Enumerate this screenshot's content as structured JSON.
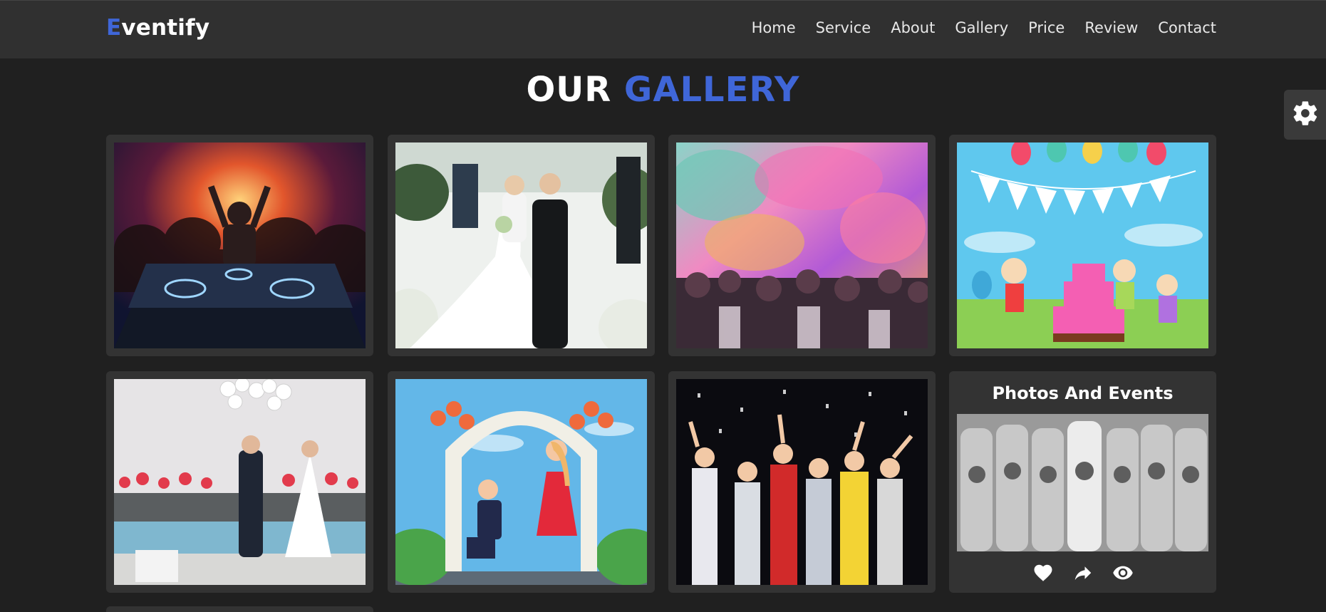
{
  "brand": {
    "first_letter": "E",
    "rest": "ventify",
    "accent_color": "#3f66d8"
  },
  "nav": {
    "items": [
      {
        "label": "Home"
      },
      {
        "label": "Service"
      },
      {
        "label": "About"
      },
      {
        "label": "Gallery"
      },
      {
        "label": "Price"
      },
      {
        "label": "Review"
      },
      {
        "label": "Contact"
      }
    ]
  },
  "section": {
    "title_plain": "OUR",
    "title_accent": "GALLERY"
  },
  "settings": {
    "icon": "gear-icon"
  },
  "gallery": {
    "items": [
      {
        "subject": "dj-concert"
      },
      {
        "subject": "wedding-couple"
      },
      {
        "subject": "holi-color-festival"
      },
      {
        "subject": "birthday-cartoon"
      },
      {
        "subject": "wedding-balloons"
      },
      {
        "subject": "proposal-cartoon"
      },
      {
        "subject": "confetti-party"
      }
    ],
    "feature_card": {
      "title": "Photos And Events",
      "subject": "bridesmaids-grayscale",
      "actions": [
        {
          "icon": "heart-icon"
        },
        {
          "icon": "share-icon"
        },
        {
          "icon": "eye-icon"
        }
      ]
    }
  }
}
